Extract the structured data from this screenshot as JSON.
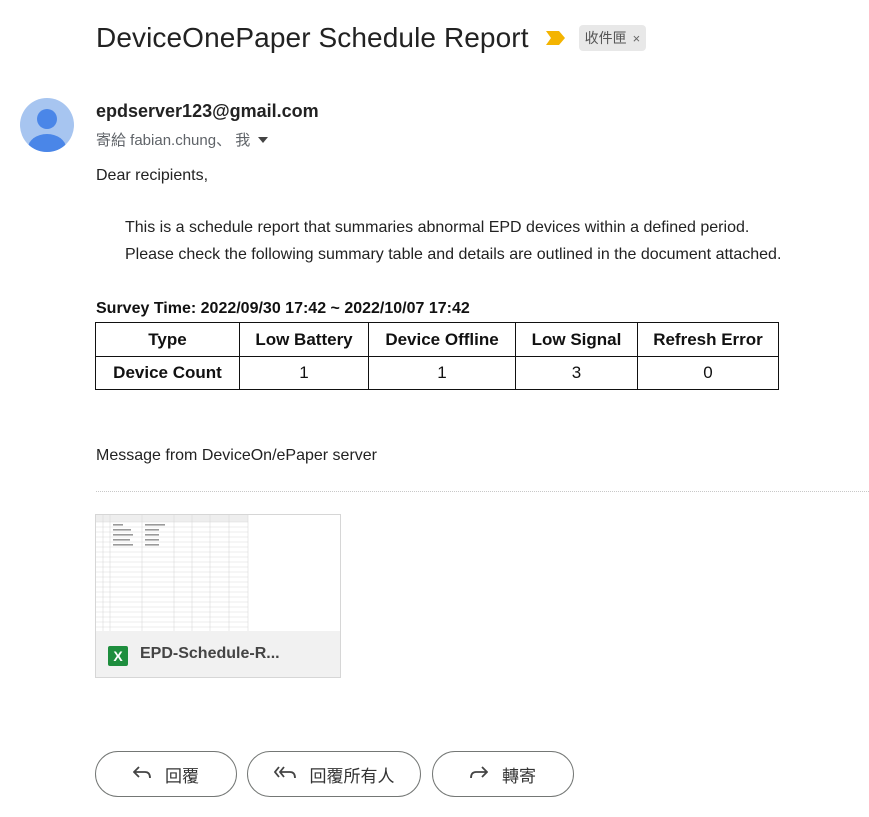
{
  "email": {
    "subject": "DeviceOnePaper Schedule Report",
    "label_chip": "收件匣",
    "label_remove": "×",
    "sender": "epdserver123@gmail.com",
    "recipients": "寄給 fabian.chung、 我"
  },
  "body": {
    "greeting": "Dear recipients,",
    "para1": "This is a schedule report that summaries abnormal EPD devices within a defined period.",
    "para2": "Please check the following summary table and details are outlined in the document attached.",
    "survey_time": "Survey Time: 2022/09/30 17:42 ~ 2022/10/07 17:42",
    "table": {
      "headers": [
        "Type",
        "Low Battery",
        "Device Offline",
        "Low Signal",
        "Refresh Error"
      ],
      "row_label": "Device Count",
      "values": [
        "1",
        "1",
        "3",
        "0"
      ]
    },
    "message": "Message from DeviceOn/ePaper server"
  },
  "attachment": {
    "name": "EPD-Schedule-R...",
    "icon_letter": "X"
  },
  "actions": {
    "reply": "回覆",
    "reply_all": "回覆所有人",
    "forward": "轉寄"
  },
  "colors": {
    "important": "#f4b400",
    "avatar_bg": "#a7c5f0",
    "avatar_fg": "#4a86e8",
    "excel_green": "#1e8e3e"
  }
}
